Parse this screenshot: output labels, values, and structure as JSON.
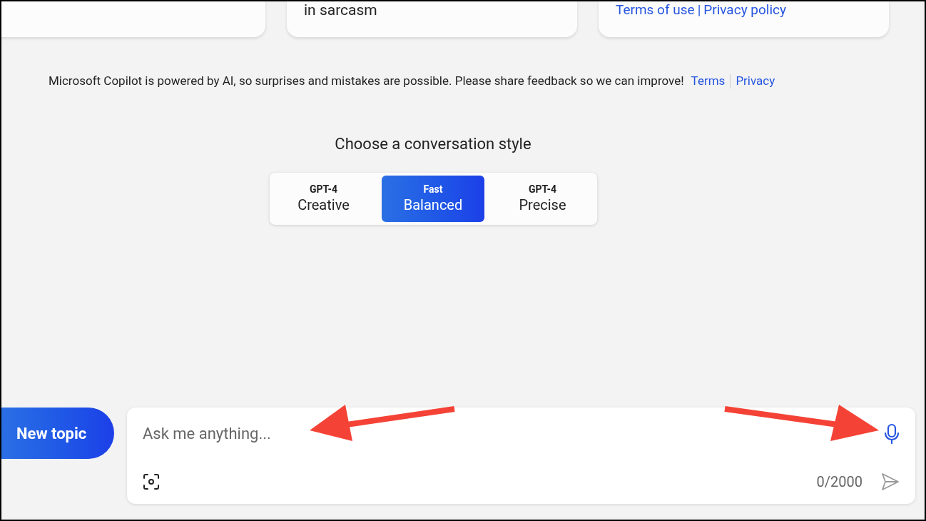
{
  "cards": [
    {
      "kind": "blank"
    },
    {
      "kind": "text",
      "text": "in sarcasm"
    },
    {
      "kind": "links",
      "links": [
        "Terms of use",
        "Privacy policy"
      ],
      "separator": "|"
    }
  ],
  "disclaimer": {
    "text": "Microsoft Copilot is powered by AI, so surprises and mistakes are possible. Please share feedback so we can improve!",
    "links": [
      "Terms",
      "Privacy"
    ]
  },
  "style_picker": {
    "title": "Choose a conversation style",
    "options": [
      {
        "model": "GPT-4",
        "label": "Creative",
        "selected": false
      },
      {
        "model": "Fast",
        "label": "Balanced",
        "selected": true
      },
      {
        "model": "GPT-4",
        "label": "Precise",
        "selected": false
      }
    ]
  },
  "new_topic": "New topic",
  "composer": {
    "placeholder": "Ask me anything...",
    "counter": "0/2000"
  },
  "annotations": [
    {
      "kind": "arrow-left"
    },
    {
      "kind": "arrow-right"
    }
  ]
}
